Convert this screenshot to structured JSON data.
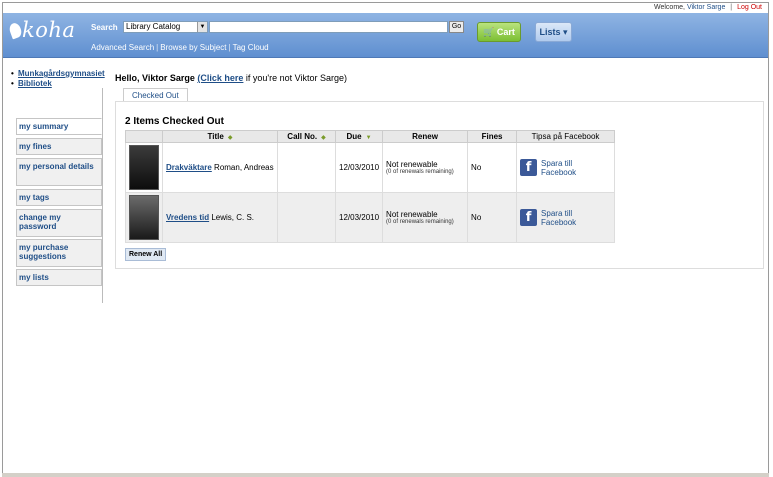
{
  "topbar": {
    "welcome": "Welcome,",
    "user": "Viktor Sarge",
    "logout": "Log Out"
  },
  "header": {
    "logo_text": "koha",
    "search_label": "Search",
    "search_scope": "Library Catalog",
    "search_value": "",
    "go_label": "Go",
    "cart_label": "Cart",
    "lists_label": "Lists ▾",
    "sub_nav": [
      "Advanced Search",
      "Browse by Subject",
      "Tag Cloud"
    ]
  },
  "sidebar": {
    "libraries": [
      "Munkagårdsgymnasiet",
      "Bibliotek"
    ],
    "menu": [
      {
        "label": "my summary",
        "active": true
      },
      {
        "label": "my fines"
      },
      {
        "label": "my personal details"
      },
      {
        "label": "my tags"
      },
      {
        "label": "change my password"
      },
      {
        "label": "my purchase suggestions"
      },
      {
        "label": "my lists"
      }
    ]
  },
  "main": {
    "hello_prefix": "Hello, Viktor Sarge",
    "hello_link": "(Click here",
    "hello_suffix": " if you're not Viktor Sarge)",
    "tab": "Checked Out",
    "heading": "2 Items Checked Out",
    "columns": [
      "Title",
      "Call No.",
      "Due",
      "Renew",
      "Fines",
      "Tipsa på Facebook"
    ],
    "rows": [
      {
        "title": "Drakväktare",
        "author": " Roman, Andreas",
        "call_no": "",
        "due": "12/03/2010",
        "renew": "Not renewable",
        "renew_sub": "(0 of renewals remaining)",
        "fines": "No",
        "fb_line1": "Spara till",
        "fb_line2": "Facebook"
      },
      {
        "title": "Vredens tid",
        "author": " Lewis, C. S.",
        "call_no": "",
        "due": "12/03/2010",
        "renew": "Not renewable",
        "renew_sub": "(0 of renewals remaining)",
        "fines": "No",
        "fb_line1": "Spara till",
        "fb_line2": "Facebook"
      }
    ],
    "renew_all": "Renew All"
  }
}
